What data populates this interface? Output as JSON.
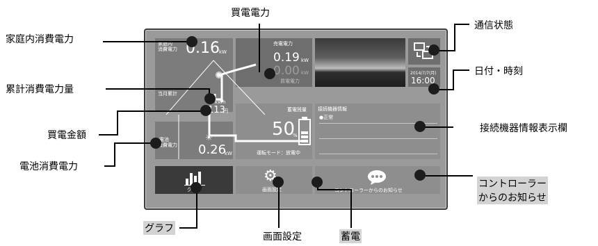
{
  "screen": {
    "consumption": {
      "title_line1": "家庭内",
      "title_line2": "消費電力",
      "value": "0.16",
      "unit": "kW"
    },
    "cumulative": {
      "label": "当月累計",
      "value": "5",
      "unit": "kWh"
    },
    "purchase_amount": {
      "value": "113",
      "unit": "円"
    },
    "sell": {
      "title": "売電電力",
      "value": "0.19",
      "unit": "kW",
      "buy_value": "0.00",
      "buy_unit": "kW",
      "buy_label": "買電電力"
    },
    "datetime": {
      "date": "2014/7/7(月)",
      "time": "16:00"
    },
    "battery": {
      "title": "蓄電残量",
      "value": "50",
      "unit": "%",
      "mode": "運転モード：放電中",
      "label_line1": "電池",
      "label_line2": "消費電力",
      "consumption_value": "0.26",
      "consumption_unit": "kW"
    },
    "device_info": {
      "title": "接続機器情報",
      "status": "●正常"
    },
    "buttons": {
      "graph": "グラフ",
      "settings": "画面設定",
      "notice": "コントローラーからのお知らせ"
    }
  },
  "callouts": {
    "home_consumption": "家庭内消費電力",
    "cumulative_consumption": "累計消費電力量",
    "purchase_amount": "買電金額",
    "battery_consumption": "電池消費電力",
    "purchase_power": "買電電力",
    "comm_status": "通信状態",
    "datetime": "日付・時刻",
    "device_info": "接続機器情報表示欄",
    "controller_notice_line1": "コントローラー",
    "controller_notice_line2": "からのお知らせ",
    "graph": "グラフ",
    "screen_settings": "画面設定",
    "storage": "蓄電"
  }
}
